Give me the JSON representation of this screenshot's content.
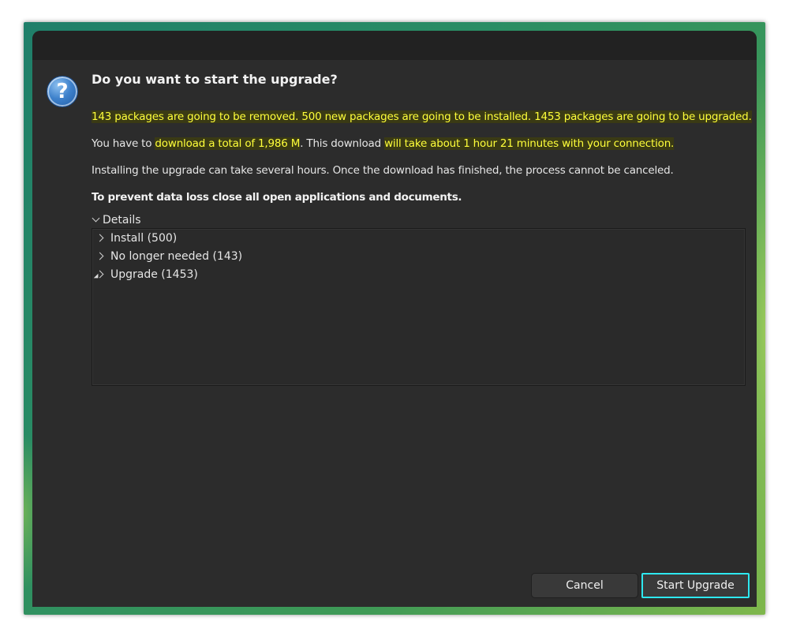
{
  "dialog": {
    "heading": "Do you want to start the upgrade?",
    "line1": "143 packages are going to be removed. 500 new packages are going to be installed. 1453 packages are going to be upgraded.",
    "line2": {
      "prefix": "You have to ",
      "hl_download": "download a total of 1,986 M",
      "middle": ". This download ",
      "hl_time": "will take about 1 hour 21 minutes with your connection."
    },
    "line3": "Installing the upgrade can take several hours. Once the download has finished, the process cannot be canceled.",
    "line4": "To prevent data loss close all open applications and documents.",
    "details_label": "Details",
    "tree": [
      {
        "label": "Install (500)"
      },
      {
        "label": "No longer needed (143)"
      },
      {
        "label": "Upgrade (1453)"
      }
    ],
    "buttons": {
      "cancel": "Cancel",
      "start": "Start Upgrade"
    }
  },
  "icons": {
    "question": "?"
  },
  "colors": {
    "highlight_text": "#ffff3a",
    "focus_ring": "#2ee8f0",
    "window_bg": "#2c2c2c"
  }
}
